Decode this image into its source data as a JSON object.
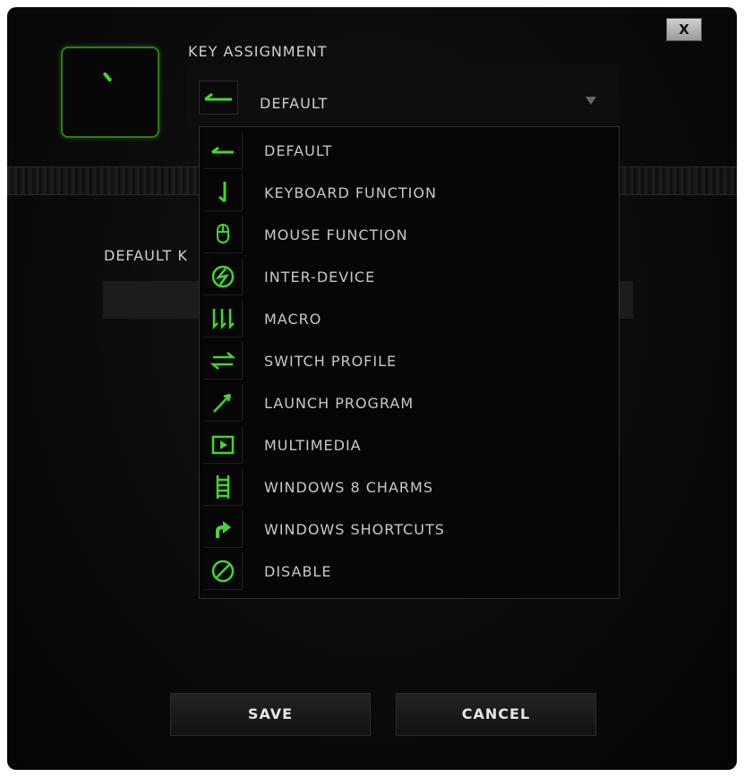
{
  "dialog": {
    "close_label": "X",
    "key_assignment_label": "KEY ASSIGNMENT",
    "default_key_label_partial": "DEFAULT K"
  },
  "select": {
    "value": "DEFAULT",
    "icon": "arrow-left-icon"
  },
  "dropdown": {
    "items": [
      {
        "label": "DEFAULT",
        "icon": "arrow-left-icon"
      },
      {
        "label": "KEYBOARD FUNCTION",
        "icon": "keyboard-arrow-icon"
      },
      {
        "label": "MOUSE FUNCTION",
        "icon": "mouse-icon"
      },
      {
        "label": "INTER-DEVICE",
        "icon": "inter-device-icon"
      },
      {
        "label": "MACRO",
        "icon": "macro-icon"
      },
      {
        "label": "SWITCH PROFILE",
        "icon": "switch-profile-icon"
      },
      {
        "label": "LAUNCH PROGRAM",
        "icon": "launch-program-icon"
      },
      {
        "label": "MULTIMEDIA",
        "icon": "multimedia-icon"
      },
      {
        "label": "WINDOWS 8 CHARMS",
        "icon": "windows-charms-icon"
      },
      {
        "label": "WINDOWS SHORTCUTS",
        "icon": "windows-shortcut-icon"
      },
      {
        "label": "DISABLE",
        "icon": "disable-icon"
      }
    ]
  },
  "buttons": {
    "save": "SAVE",
    "cancel": "CANCEL"
  },
  "colors": {
    "accent": "#44d62c",
    "background": "#0b0b0b",
    "text": "#cfcfcf"
  }
}
